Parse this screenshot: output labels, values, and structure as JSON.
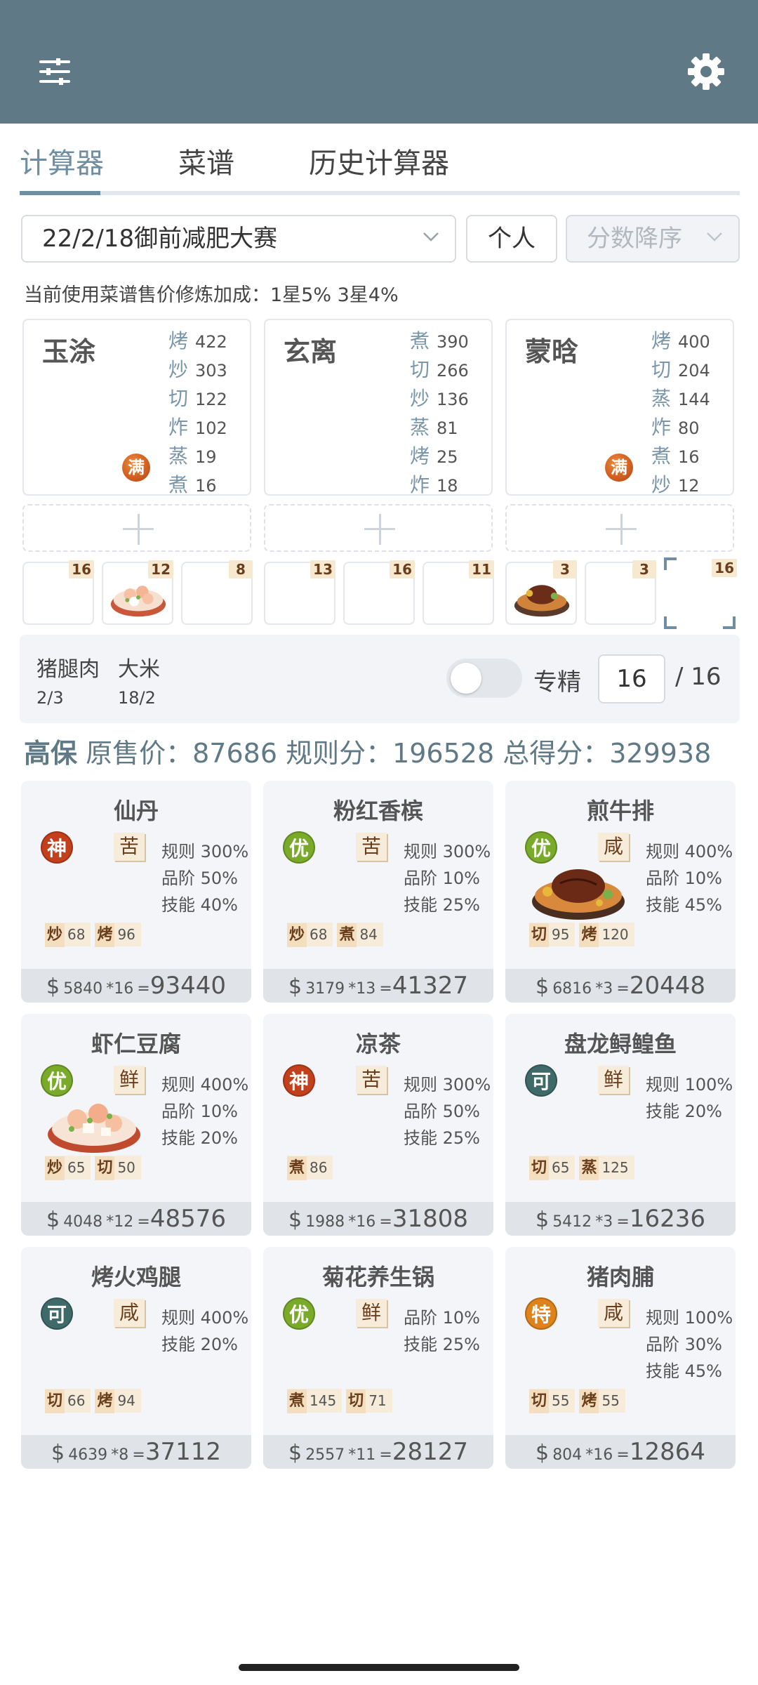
{
  "tabs": [
    "计算器",
    "菜谱",
    "历史计算器"
  ],
  "controls": {
    "rule_select": "22/2/18御前减肥大赛",
    "mode_button": "个人",
    "sort_select": "分数降序"
  },
  "hint": "当前使用菜谱售价修炼加成：1星5% 3星4%",
  "chefs": [
    {
      "name": "玉涂",
      "skills": [
        [
          "烤",
          "422"
        ],
        [
          "炒",
          "303"
        ],
        [
          "切",
          "122"
        ],
        [
          "炸",
          "102"
        ],
        [
          "蒸",
          "19"
        ],
        [
          "煮",
          "16"
        ]
      ],
      "badge": "满"
    },
    {
      "name": "玄离",
      "skills": [
        [
          "煮",
          "390"
        ],
        [
          "切",
          "266"
        ],
        [
          "炒",
          "136"
        ],
        [
          "蒸",
          "81"
        ],
        [
          "烤",
          "25"
        ],
        [
          "炸",
          "18"
        ]
      ],
      "badge": ""
    },
    {
      "name": "蒙晗",
      "skills": [
        [
          "烤",
          "400"
        ],
        [
          "切",
          "204"
        ],
        [
          "蒸",
          "144"
        ],
        [
          "炸",
          "80"
        ],
        [
          "煮",
          "16"
        ],
        [
          "炒",
          "12"
        ]
      ],
      "badge": "满"
    }
  ],
  "tool_slots": [
    "16",
    "12",
    "8",
    "13",
    "16",
    "11",
    "3",
    "3",
    "16"
  ],
  "materials": {
    "items": [
      {
        "name": "猪腿肉",
        "count": "2/3"
      },
      {
        "name": "大米",
        "count": "18/2"
      }
    ],
    "specialize_label": "专精",
    "specialize_on": false,
    "quantity": "16",
    "max": "/ 16"
  },
  "summary": {
    "grade": "高保",
    "text": "原售价：87686 规则分：196528 总得分：329938"
  },
  "colors": {
    "topbar": "#5f7a86",
    "accent": "#6f8ea2",
    "grade_shen": "#c2401c",
    "grade_you": "#7aaa2a",
    "grade_ke": "#3f6a6a",
    "grade_te": "#e0821c"
  },
  "dishes": [
    {
      "name": "仙丹",
      "grade": "神",
      "flavor": "苦",
      "rules": [
        "规则 300%",
        "品阶 50%",
        "技能 40%"
      ],
      "req": [
        [
          "炒",
          "68"
        ],
        [
          "烤",
          "96"
        ]
      ],
      "price": "5840",
      "qty": "*16",
      "total": "93440",
      "art": ""
    },
    {
      "name": "粉红香槟",
      "grade": "优",
      "flavor": "苦",
      "rules": [
        "规则 300%",
        "品阶 10%",
        "技能 25%"
      ],
      "req": [
        [
          "炒",
          "68"
        ],
        [
          "煮",
          "84"
        ]
      ],
      "price": "3179",
      "qty": "*13",
      "total": "41327",
      "art": ""
    },
    {
      "name": "煎牛排",
      "grade": "优",
      "flavor": "咸",
      "rules": [
        "规则 400%",
        "品阶 10%",
        "技能 45%"
      ],
      "req": [
        [
          "切",
          "95"
        ],
        [
          "烤",
          "120"
        ]
      ],
      "price": "6816",
      "qty": "*3",
      "total": "20448",
      "art": "steak"
    },
    {
      "name": "虾仁豆腐",
      "grade": "优",
      "flavor": "鲜",
      "rules": [
        "规则 400%",
        "品阶 10%",
        "技能 20%"
      ],
      "req": [
        [
          "炒",
          "65"
        ],
        [
          "切",
          "50"
        ]
      ],
      "price": "4048",
      "qty": "*12",
      "total": "48576",
      "art": "shrimp"
    },
    {
      "name": "凉茶",
      "grade": "神",
      "flavor": "苦",
      "rules": [
        "规则 300%",
        "品阶 50%",
        "技能 25%"
      ],
      "req": [
        [
          "煮",
          "86"
        ]
      ],
      "price": "1988",
      "qty": "*16",
      "total": "31808",
      "art": ""
    },
    {
      "name": "盘龙鲟鳇鱼",
      "grade": "可",
      "flavor": "鲜",
      "rules": [
        "规则 100%",
        "技能 20%"
      ],
      "req": [
        [
          "切",
          "65"
        ],
        [
          "蒸",
          "125"
        ]
      ],
      "price": "5412",
      "qty": "*3",
      "total": "16236",
      "art": ""
    },
    {
      "name": "烤火鸡腿",
      "grade": "可",
      "flavor": "咸",
      "rules": [
        "规则 400%",
        "技能 20%"
      ],
      "req": [
        [
          "切",
          "66"
        ],
        [
          "烤",
          "94"
        ]
      ],
      "price": "4639",
      "qty": "*8",
      "total": "37112",
      "art": ""
    },
    {
      "name": "菊花养生锅",
      "grade": "优",
      "flavor": "鲜",
      "rules": [
        "品阶 10%",
        "技能 25%"
      ],
      "req": [
        [
          "煮",
          "145"
        ],
        [
          "切",
          "71"
        ]
      ],
      "price": "2557",
      "qty": "*11",
      "total": "28127",
      "art": ""
    },
    {
      "name": "猪肉脯",
      "grade": "特",
      "flavor": "咸",
      "rules": [
        "规则 100%",
        "品阶 30%",
        "技能 45%"
      ],
      "req": [
        [
          "切",
          "55"
        ],
        [
          "烤",
          "55"
        ]
      ],
      "price": "804",
      "qty": "*16",
      "total": "12864",
      "art": ""
    }
  ]
}
